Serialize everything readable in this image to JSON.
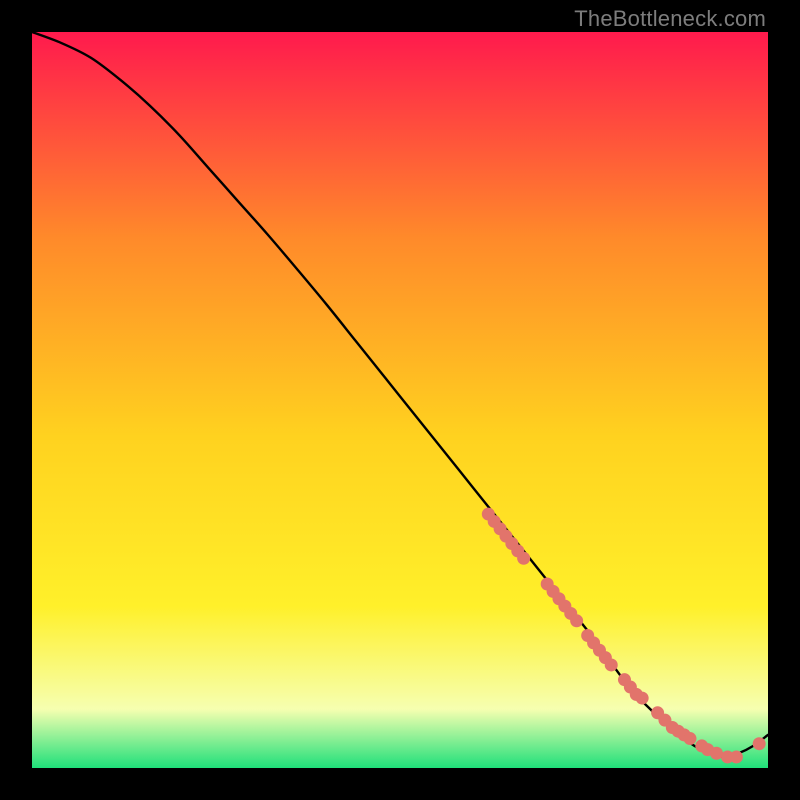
{
  "watermark": "TheBottleneck.com",
  "chart_data": {
    "type": "line",
    "title": "",
    "xlabel": "",
    "ylabel": "",
    "xlim": [
      0,
      100
    ],
    "ylim": [
      0,
      100
    ],
    "curve": {
      "name": "bottleneck-curve",
      "x": [
        0,
        4,
        8,
        12,
        16,
        20,
        24,
        28,
        32,
        36,
        40,
        44,
        48,
        52,
        56,
        60,
        64,
        68,
        72,
        76,
        80,
        82,
        84,
        86,
        88,
        90,
        92,
        94,
        96,
        98,
        100
      ],
      "y": [
        100,
        98.5,
        96.5,
        93.5,
        90,
        86,
        81.5,
        77,
        72.5,
        67.8,
        63,
        58,
        53,
        48,
        43,
        38,
        33,
        28,
        23,
        18,
        12.5,
        10,
        8,
        6,
        4.5,
        3,
        2,
        1.5,
        2,
        3,
        4.5
      ]
    },
    "points": {
      "name": "highlight-dots",
      "color": "#e2746b",
      "x": [
        62,
        62.8,
        63.6,
        64.4,
        65.2,
        66,
        66.8,
        70,
        70.8,
        71.6,
        72.4,
        73.2,
        74,
        75.5,
        76.3,
        77.1,
        77.9,
        78.7,
        80.5,
        81.3,
        82.1,
        82.9,
        85,
        86,
        87,
        87.8,
        88.6,
        89.4,
        91,
        91.8,
        93,
        94.5,
        95.7,
        98.8
      ],
      "y": [
        34.5,
        33.5,
        32.5,
        31.5,
        30.5,
        29.5,
        28.5,
        25,
        24,
        23,
        22,
        21,
        20,
        18,
        17,
        16,
        15,
        14,
        12,
        11,
        10,
        9.5,
        7.5,
        6.5,
        5.5,
        5,
        4.5,
        4,
        3,
        2.5,
        2,
        1.5,
        1.5,
        3.3
      ]
    },
    "background_gradient": {
      "top": "#ff1a4d",
      "upper_mid": "#ff8a2a",
      "mid": "#ffd21f",
      "lower_mid": "#fff02a",
      "pale": "#f6ffb0",
      "bottom": "#1fe07a"
    }
  }
}
